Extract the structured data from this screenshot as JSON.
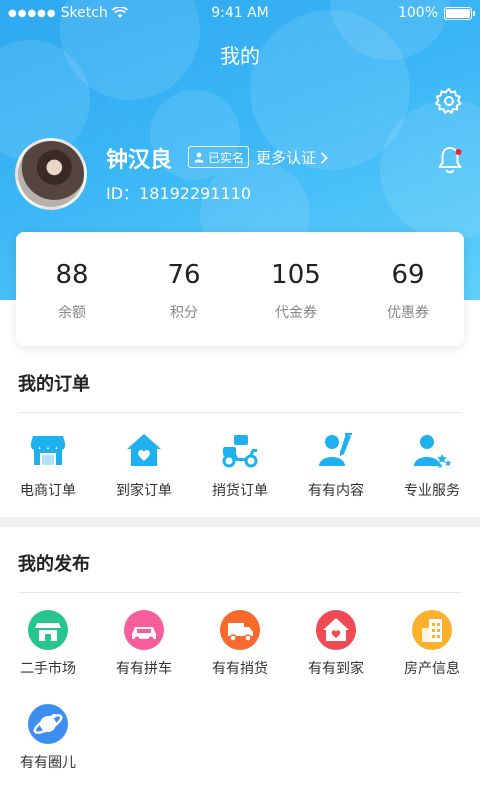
{
  "status_bar": {
    "carrier": "Sketch",
    "time": "9:41 AM",
    "battery": "100%"
  },
  "page_title": "我的",
  "user": {
    "name": "钟汉良",
    "verified_badge": "已实名",
    "more_cert": "更多认证",
    "id_line": "ID：18192291110"
  },
  "stats": [
    {
      "value": "88",
      "label": "余额"
    },
    {
      "value": "76",
      "label": "积分"
    },
    {
      "value": "105",
      "label": "代金券"
    },
    {
      "value": "69",
      "label": "优惠券"
    }
  ],
  "orders": {
    "title": "我的订单",
    "items": [
      {
        "label": "电商订单",
        "icon": "shop-icon"
      },
      {
        "label": "到家订单",
        "icon": "home-heart-icon"
      },
      {
        "label": "捎货订单",
        "icon": "scooter-icon"
      },
      {
        "label": "有有内容",
        "icon": "person-pen-icon"
      },
      {
        "label": "专业服务",
        "icon": "person-star-icon"
      }
    ]
  },
  "publish": {
    "title": "我的发布",
    "items": [
      {
        "label": "二手市场",
        "icon": "market-icon",
        "color": "#27c48f"
      },
      {
        "label": "有有拼车",
        "icon": "car-icon",
        "color": "#f75c9b"
      },
      {
        "label": "有有捎货",
        "icon": "truck-icon",
        "color": "#f76a2c"
      },
      {
        "label": "有有到家",
        "icon": "house-icon",
        "color": "#f04a55"
      },
      {
        "label": "房产信息",
        "icon": "building-icon",
        "color": "#fbb12c"
      },
      {
        "label": "有有圈儿",
        "icon": "planet-icon",
        "color": "#3c8ef0"
      }
    ]
  },
  "colors": {
    "accent": "#1fb0f0",
    "header_start": "#2ea8f0",
    "header_end": "#5fd0fb"
  }
}
